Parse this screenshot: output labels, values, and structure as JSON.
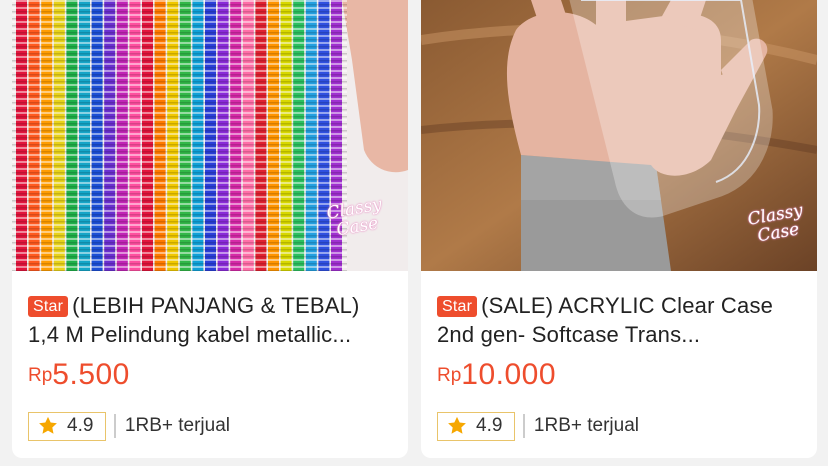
{
  "products": [
    {
      "badge": "Star",
      "title": "(LEBIH PANJANG & TEBAL) 1,4 M Pelindung kabel metallic...",
      "currency": "Rp",
      "price": "5.500",
      "rating": "4.9",
      "sold": "1RB+ terjual",
      "image_alt": "colorful metallic spiral cable protectors",
      "watermark_line1": "Classy",
      "watermark_line2": "Case"
    },
    {
      "badge": "Star",
      "title": "(SALE) ACRYLIC Clear Case 2nd gen- Softcase Trans...",
      "currency": "Rp",
      "price": "10.000",
      "rating": "4.9",
      "sold": "1RB+ terjual",
      "image_alt": "hand holding transparent acrylic phone case",
      "watermark_line1": "Classy",
      "watermark_line2": "Case"
    }
  ],
  "colors": {
    "accent": "#ee4d2d",
    "rating_border": "#e9c46a",
    "star": "#f6a700"
  },
  "icons": [
    "star-icon"
  ]
}
